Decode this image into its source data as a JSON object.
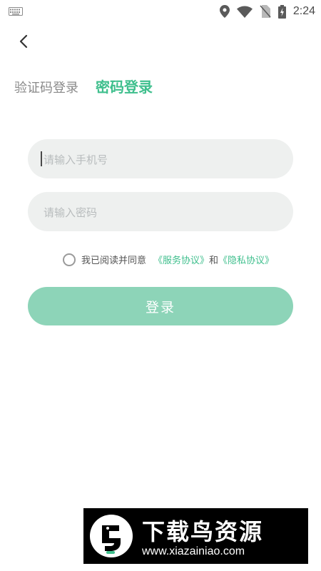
{
  "status_bar": {
    "time": "2:24"
  },
  "tabs": [
    {
      "label": "验证码登录",
      "active": false
    },
    {
      "label": "密码登录",
      "active": true
    }
  ],
  "form": {
    "phone_placeholder": "请输入手机号",
    "password_placeholder": "请输入密码",
    "agree_text": "我已阅读并同意",
    "service_link": "《服务协议》",
    "and_text": "和",
    "privacy_link": "《隐私协议》",
    "login_label": "登录"
  },
  "watermark": {
    "title": "下载鸟资源",
    "url": "www.xiazainiao.com"
  },
  "colors": {
    "accent": "#3fbf8d",
    "button": "#8dd4b8",
    "field_bg": "#eef0ef"
  }
}
